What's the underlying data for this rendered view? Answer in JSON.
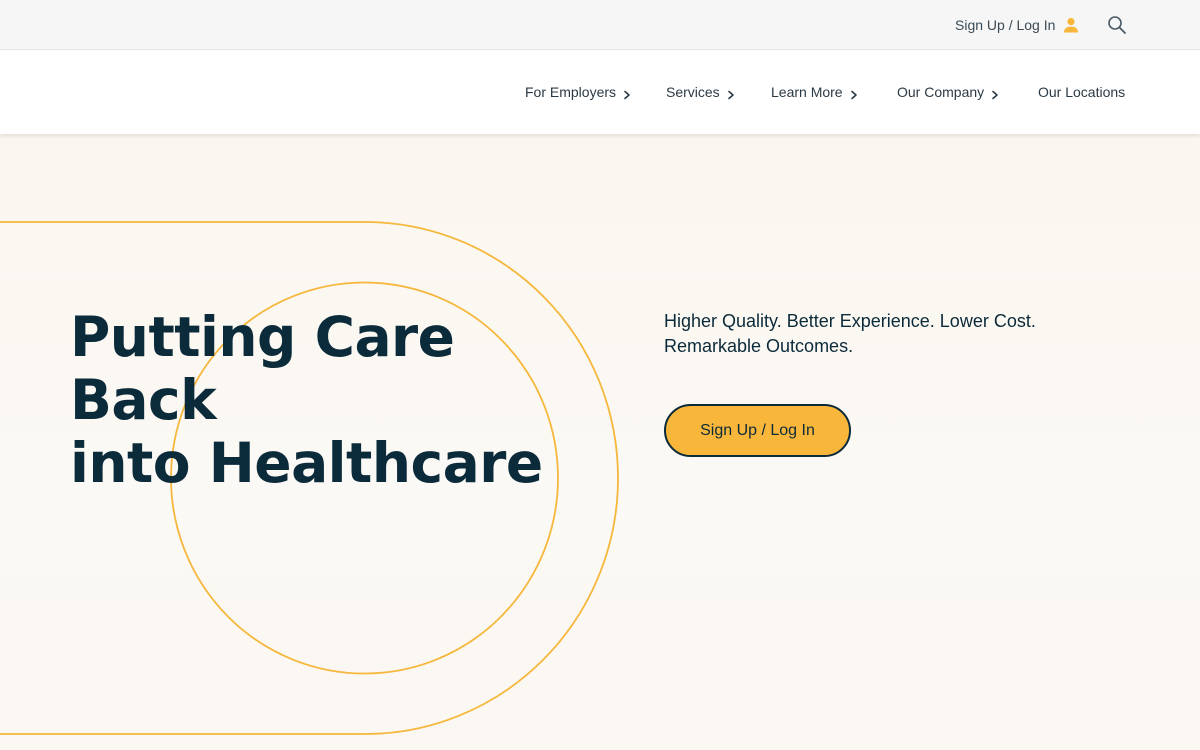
{
  "utility": {
    "signin_label": "Sign Up / Log In",
    "icons": {
      "account": "person-icon",
      "search": "search-icon"
    }
  },
  "nav": {
    "items": [
      {
        "label": "For Employers",
        "has_submenu": true
      },
      {
        "label": "Services",
        "has_submenu": true
      },
      {
        "label": "Learn More",
        "has_submenu": true
      },
      {
        "label": "Our Company",
        "has_submenu": true
      },
      {
        "label": "Our Locations",
        "has_submenu": false
      }
    ]
  },
  "hero": {
    "headline_line1": "Putting Care Back",
    "headline_line2": "into Healthcare",
    "tagline_line1": "Higher Quality. Better Experience. Lower Cost.",
    "tagline_line2": "Remarkable Outcomes.",
    "cta_label": "Sign Up / Log In"
  },
  "colors": {
    "accent": "#f8b63a",
    "navy": "#0b2a3a",
    "hero_background": "#fbf8f3"
  }
}
